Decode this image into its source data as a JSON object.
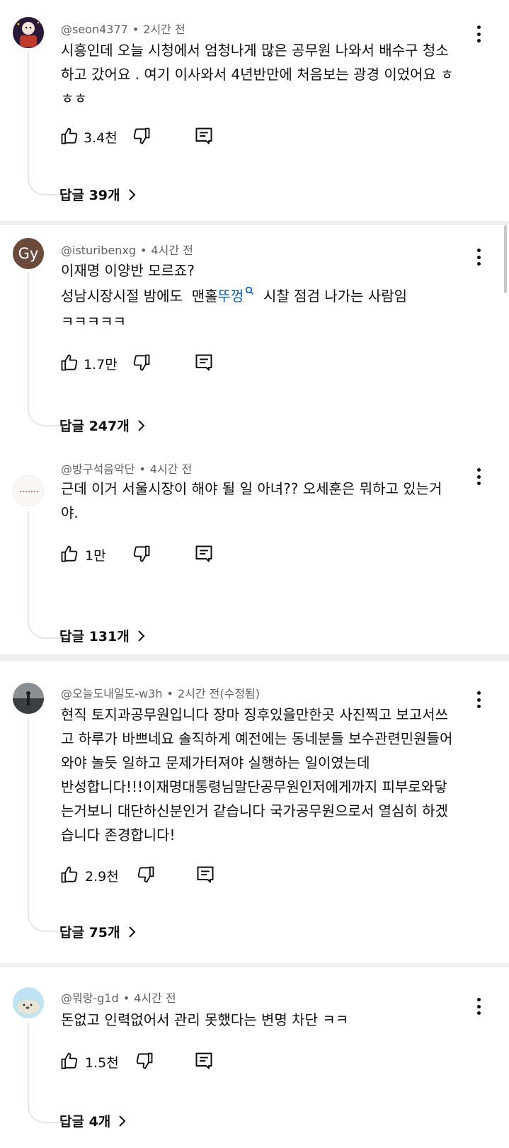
{
  "comments": [
    {
      "author": "@seon4377",
      "time": "2시간 전",
      "lines": [
        "시흥인데 오늘 시청에서 엄청나게 많은 공무원 나와서 배수구 청소",
        "하고 갔어요 . 여기 이사와서 4년반만에 처음보는 광경 이었어요 ㅎ",
        "ㅎㅎ"
      ],
      "likes": "3.4천",
      "replies": "답글 39개"
    },
    {
      "author": "@isturibenxg",
      "avatar_text": "Gy",
      "time": "4시간 전",
      "line1": "이재명 이양반 모르죠?",
      "line2_pre": "성남시장시절 밤에도  맨홀",
      "line2_link": "뚜껑",
      "line2_post": "  시찰 점검 나가는 사람임",
      "line3": "ㅋㅋㅋㅋㅋ",
      "likes": "1.7만",
      "replies": "답글 247개"
    },
    {
      "author": "@방구석음악단",
      "time": "4시간 전",
      "lines": [
        "근데 이거 서울시장이 해야 될 일 아녀?? 오세훈은 뭐하고 있는거",
        "야."
      ],
      "likes": "1만",
      "replies": "답글 131개"
    },
    {
      "author": "@오늘도내일도-w3h",
      "time": "2시간 전(수정됨)",
      "lines": [
        "현직 토지과공무원입니다 장마 징후있을만한곳 사진찍고 보고서쓰",
        "고 하루가 바쁘네요 솔직하게 예전에는 동네분들 보수관련민원들어",
        "와야 놀듯 일하고 문제가터져야 실행하는 일이였는데",
        "반성합니다!!!이재명대통령님말단공무원인저에게까지 피부로와닿",
        "는거보니 대단하신분인거 같습니다 국가공무원으로서 열심히 하겠",
        "습니다 존경합니다!"
      ],
      "likes": "2.9천",
      "replies": "답글 75개"
    },
    {
      "author": "@뭐랑-g1d",
      "time": "4시간 전",
      "lines": [
        "돈없고 인력없어서 관리 못했다는 변명 차단 ㅋㅋ"
      ],
      "likes": "1.5천",
      "replies": "답글 4개"
    }
  ],
  "separator": "•",
  "colors": {
    "background": "#f0f0f0",
    "card": "#ffffff",
    "text": "#0f0f0f",
    "meta": "#606060",
    "link": "#065fd4",
    "thread_line": "#e5e5e5",
    "avatar_gy": "#6b4a3a"
  },
  "icons": {
    "like": "thumbs-up-icon",
    "dislike": "thumbs-down-icon",
    "reply": "reply-comment-icon",
    "more": "kebab-menu-icon",
    "chevron": "chevron-right-icon",
    "search": "search-icon"
  }
}
